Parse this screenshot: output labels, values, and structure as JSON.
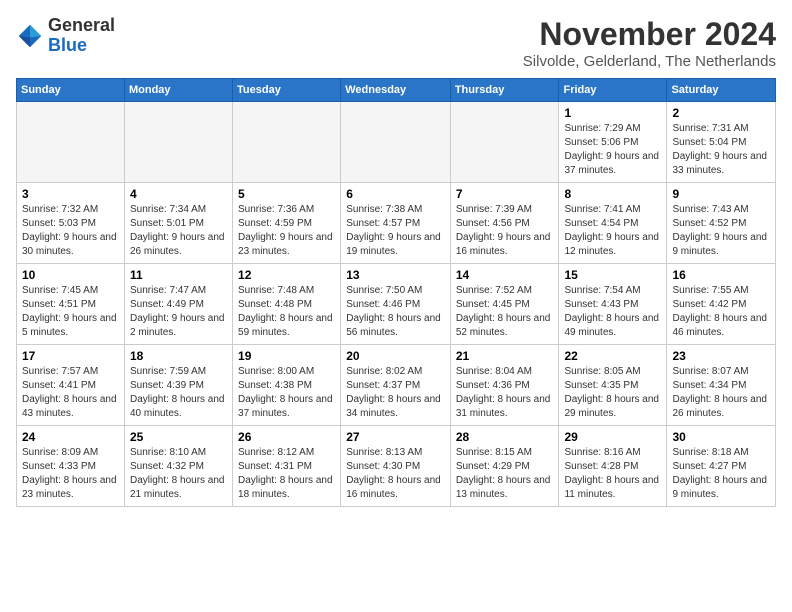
{
  "header": {
    "logo_general": "General",
    "logo_blue": "Blue",
    "month": "November 2024",
    "location": "Silvolde, Gelderland, The Netherlands"
  },
  "weekdays": [
    "Sunday",
    "Monday",
    "Tuesday",
    "Wednesday",
    "Thursday",
    "Friday",
    "Saturday"
  ],
  "weeks": [
    [
      {
        "day": "",
        "info": ""
      },
      {
        "day": "",
        "info": ""
      },
      {
        "day": "",
        "info": ""
      },
      {
        "day": "",
        "info": ""
      },
      {
        "day": "",
        "info": ""
      },
      {
        "day": "1",
        "info": "Sunrise: 7:29 AM\nSunset: 5:06 PM\nDaylight: 9 hours and 37 minutes."
      },
      {
        "day": "2",
        "info": "Sunrise: 7:31 AM\nSunset: 5:04 PM\nDaylight: 9 hours and 33 minutes."
      }
    ],
    [
      {
        "day": "3",
        "info": "Sunrise: 7:32 AM\nSunset: 5:03 PM\nDaylight: 9 hours and 30 minutes."
      },
      {
        "day": "4",
        "info": "Sunrise: 7:34 AM\nSunset: 5:01 PM\nDaylight: 9 hours and 26 minutes."
      },
      {
        "day": "5",
        "info": "Sunrise: 7:36 AM\nSunset: 4:59 PM\nDaylight: 9 hours and 23 minutes."
      },
      {
        "day": "6",
        "info": "Sunrise: 7:38 AM\nSunset: 4:57 PM\nDaylight: 9 hours and 19 minutes."
      },
      {
        "day": "7",
        "info": "Sunrise: 7:39 AM\nSunset: 4:56 PM\nDaylight: 9 hours and 16 minutes."
      },
      {
        "day": "8",
        "info": "Sunrise: 7:41 AM\nSunset: 4:54 PM\nDaylight: 9 hours and 12 minutes."
      },
      {
        "day": "9",
        "info": "Sunrise: 7:43 AM\nSunset: 4:52 PM\nDaylight: 9 hours and 9 minutes."
      }
    ],
    [
      {
        "day": "10",
        "info": "Sunrise: 7:45 AM\nSunset: 4:51 PM\nDaylight: 9 hours and 5 minutes."
      },
      {
        "day": "11",
        "info": "Sunrise: 7:47 AM\nSunset: 4:49 PM\nDaylight: 9 hours and 2 minutes."
      },
      {
        "day": "12",
        "info": "Sunrise: 7:48 AM\nSunset: 4:48 PM\nDaylight: 8 hours and 59 minutes."
      },
      {
        "day": "13",
        "info": "Sunrise: 7:50 AM\nSunset: 4:46 PM\nDaylight: 8 hours and 56 minutes."
      },
      {
        "day": "14",
        "info": "Sunrise: 7:52 AM\nSunset: 4:45 PM\nDaylight: 8 hours and 52 minutes."
      },
      {
        "day": "15",
        "info": "Sunrise: 7:54 AM\nSunset: 4:43 PM\nDaylight: 8 hours and 49 minutes."
      },
      {
        "day": "16",
        "info": "Sunrise: 7:55 AM\nSunset: 4:42 PM\nDaylight: 8 hours and 46 minutes."
      }
    ],
    [
      {
        "day": "17",
        "info": "Sunrise: 7:57 AM\nSunset: 4:41 PM\nDaylight: 8 hours and 43 minutes."
      },
      {
        "day": "18",
        "info": "Sunrise: 7:59 AM\nSunset: 4:39 PM\nDaylight: 8 hours and 40 minutes."
      },
      {
        "day": "19",
        "info": "Sunrise: 8:00 AM\nSunset: 4:38 PM\nDaylight: 8 hours and 37 minutes."
      },
      {
        "day": "20",
        "info": "Sunrise: 8:02 AM\nSunset: 4:37 PM\nDaylight: 8 hours and 34 minutes."
      },
      {
        "day": "21",
        "info": "Sunrise: 8:04 AM\nSunset: 4:36 PM\nDaylight: 8 hours and 31 minutes."
      },
      {
        "day": "22",
        "info": "Sunrise: 8:05 AM\nSunset: 4:35 PM\nDaylight: 8 hours and 29 minutes."
      },
      {
        "day": "23",
        "info": "Sunrise: 8:07 AM\nSunset: 4:34 PM\nDaylight: 8 hours and 26 minutes."
      }
    ],
    [
      {
        "day": "24",
        "info": "Sunrise: 8:09 AM\nSunset: 4:33 PM\nDaylight: 8 hours and 23 minutes."
      },
      {
        "day": "25",
        "info": "Sunrise: 8:10 AM\nSunset: 4:32 PM\nDaylight: 8 hours and 21 minutes."
      },
      {
        "day": "26",
        "info": "Sunrise: 8:12 AM\nSunset: 4:31 PM\nDaylight: 8 hours and 18 minutes."
      },
      {
        "day": "27",
        "info": "Sunrise: 8:13 AM\nSunset: 4:30 PM\nDaylight: 8 hours and 16 minutes."
      },
      {
        "day": "28",
        "info": "Sunrise: 8:15 AM\nSunset: 4:29 PM\nDaylight: 8 hours and 13 minutes."
      },
      {
        "day": "29",
        "info": "Sunrise: 8:16 AM\nSunset: 4:28 PM\nDaylight: 8 hours and 11 minutes."
      },
      {
        "day": "30",
        "info": "Sunrise: 8:18 AM\nSunset: 4:27 PM\nDaylight: 8 hours and 9 minutes."
      }
    ]
  ]
}
